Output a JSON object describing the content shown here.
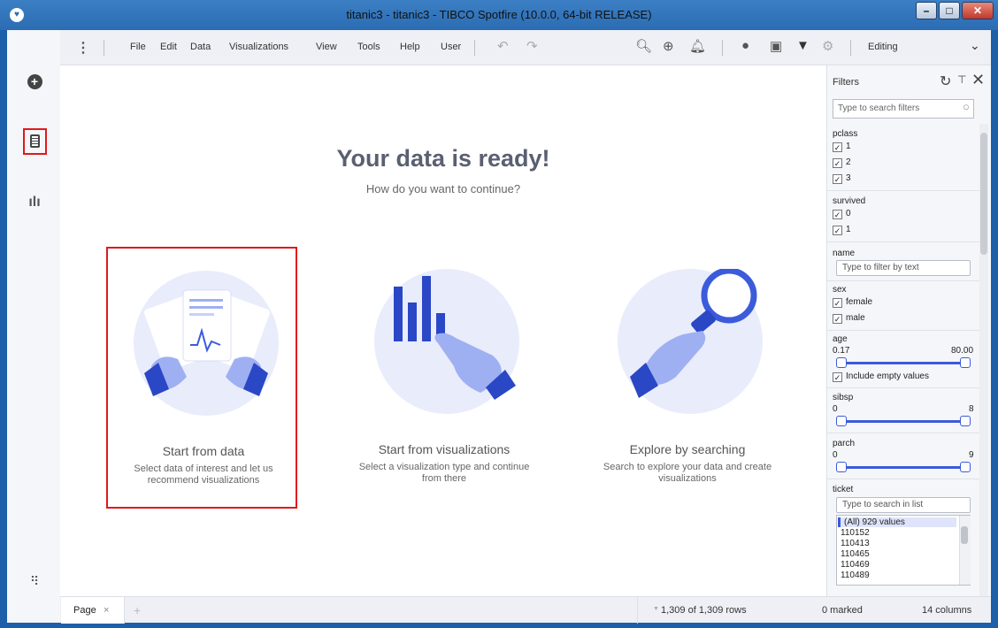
{
  "window": {
    "title": "titanic3 - titanic3 - TIBCO Spotfire (10.0.0, 64-bit RELEASE)",
    "logo_glyph": "♥",
    "minimize": "–",
    "maximize": "□",
    "close": "✕"
  },
  "leftbar": {
    "add_glyph": "+",
    "viz_glyph": "ılı",
    "flow_glyph": "⠻"
  },
  "menu": {
    "dots": "⋮",
    "items": [
      "File",
      "Edit",
      "Data",
      "Visualizations",
      "View",
      "Tools",
      "Help",
      "User"
    ],
    "undo": "↶",
    "redo": "↷",
    "mode": "Editing",
    "mode_arrow": "⌄",
    "icons": {
      "search": "🔍︎",
      "globe": "⊕",
      "bell": "🔔︎",
      "chat": "●",
      "bookmark": "▣",
      "filter": "▼",
      "settings": "⚙"
    }
  },
  "main": {
    "title": "Your data is ready!",
    "subtitle": "How do you want to continue?",
    "cards": [
      {
        "title": "Start from data",
        "desc": "Select data of interest and let us recommend visualizations"
      },
      {
        "title": "Start from visualizations",
        "desc": "Select a visualization type and continue from there"
      },
      {
        "title": "Explore by searching",
        "desc": "Search to explore your data and create visualizations"
      }
    ]
  },
  "filters": {
    "title": "Filters",
    "reset": "↻",
    "pin": "⊤",
    "close": "✕",
    "search_placeholder": "Type to search filters",
    "check": "✓",
    "pclass": {
      "label": "pclass",
      "values": [
        "1",
        "2",
        "3"
      ]
    },
    "survived": {
      "label": "survived",
      "values": [
        "0",
        "1"
      ]
    },
    "name": {
      "label": "name",
      "placeholder": "Type to filter by text"
    },
    "sex": {
      "label": "sex",
      "values": [
        "female",
        "male"
      ]
    },
    "age": {
      "label": "age",
      "min": "0.17",
      "max": "80.00",
      "include_empty": "Include empty values"
    },
    "sibsp": {
      "label": "sibsp",
      "min": "0",
      "max": "8"
    },
    "parch": {
      "label": "parch",
      "min": "0",
      "max": "9"
    },
    "ticket": {
      "label": "ticket",
      "placeholder": "Type to search in list",
      "values": [
        "(All) 929 values",
        "110152",
        "110413",
        "110465",
        "110469",
        "110489"
      ]
    }
  },
  "status": {
    "page_tab": "Page",
    "tab_close": "×",
    "add_page": "+",
    "rows": "1,309 of 1,309 rows",
    "marked": "0 marked",
    "columns": "14 columns",
    "rows_arrow": "▼"
  },
  "colors": {
    "accent": "#3b5bdb",
    "highlight": "#e0191b",
    "title_bar": "#2b6cb3"
  }
}
